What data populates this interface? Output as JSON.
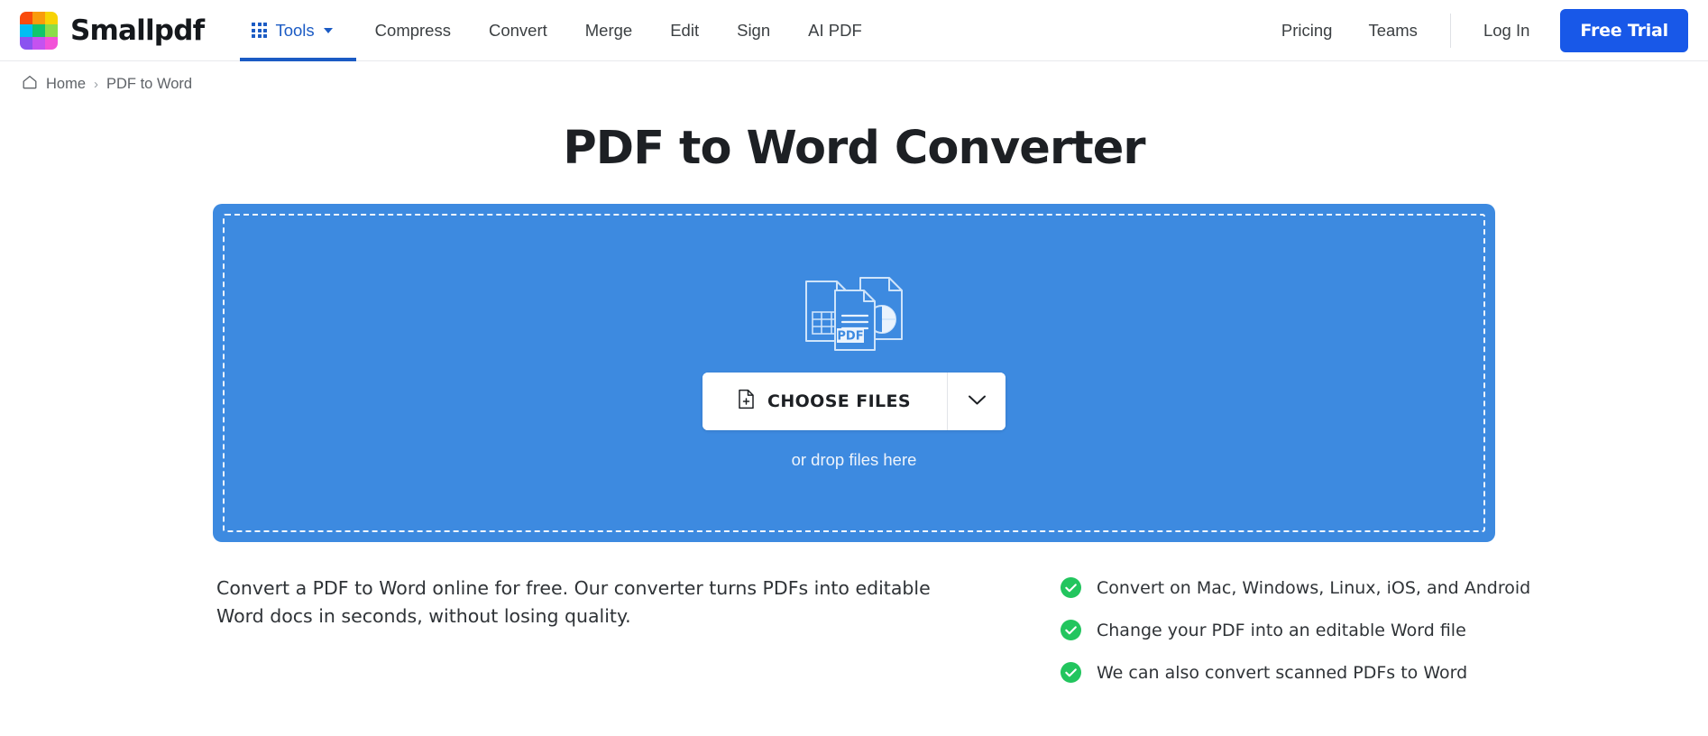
{
  "brand": {
    "name": "Smallpdf",
    "logo_colors": [
      "#f94b0c",
      "#f99b0c",
      "#f7d305",
      "#00bdf2",
      "#10c56d",
      "#8bdd4a",
      "#8b52f0",
      "#c452f0",
      "#f252d8"
    ]
  },
  "nav": {
    "tools_label": "Tools",
    "links": [
      {
        "label": "Compress"
      },
      {
        "label": "Convert"
      },
      {
        "label": "Merge"
      },
      {
        "label": "Edit"
      },
      {
        "label": "Sign"
      },
      {
        "label": "AI PDF"
      }
    ],
    "right_links": [
      {
        "label": "Pricing"
      },
      {
        "label": "Teams"
      }
    ],
    "login_label": "Log In",
    "trial_label": "Free Trial",
    "accent_color": "#1b5bc4",
    "trial_bg": "#1858e8"
  },
  "breadcrumb": {
    "home_label": "Home",
    "separator": "›",
    "current_label": "PDF to Word"
  },
  "page": {
    "title": "PDF to Word Converter"
  },
  "dropzone": {
    "choose_label": "CHOOSE FILES",
    "drop_hint": "or drop files here",
    "pdf_badge": "PDF",
    "bg_color": "#3d8ae0"
  },
  "description": {
    "text": "Convert a PDF to Word online for free. Our converter turns PDFs into editable Word docs in seconds, without losing quality."
  },
  "features": {
    "check_color": "#22c55e",
    "items": [
      {
        "label": "Convert on Mac, Windows, Linux, iOS, and Android"
      },
      {
        "label": "Change your PDF into an editable Word file"
      },
      {
        "label": "We can also convert scanned PDFs to Word"
      }
    ]
  }
}
